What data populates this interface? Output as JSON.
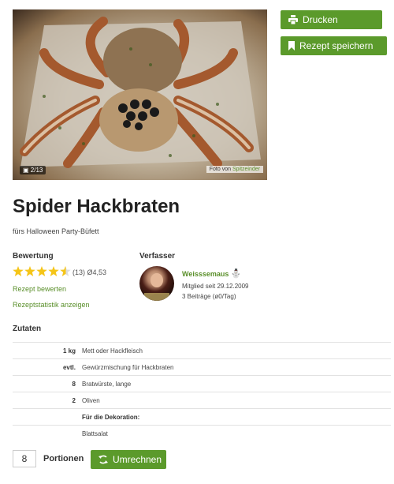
{
  "photo": {
    "count": "2/13",
    "credit_prefix": "Foto von",
    "credit_author": "Spitzeinder"
  },
  "actions": {
    "print_label": "Drucken",
    "save_label": "Rezept speichern"
  },
  "recipe": {
    "title": "Spider Hackbraten",
    "subtitle": "fürs Halloween Party-Büfett"
  },
  "rating": {
    "heading": "Bewertung",
    "stars": 4.5,
    "summary": "(13) Ø4,53",
    "rate_link": "Rezept bewerten",
    "stats_link": "Rezeptstatistik anzeigen"
  },
  "author": {
    "heading": "Verfasser",
    "name": "Weisssemaus",
    "member_since": "Mitglied seit 29.12.2009",
    "posts": "3 Beiträge (ø0/Tag)"
  },
  "ingredients": {
    "heading": "Zutaten",
    "rows": [
      {
        "amount": "1 kg",
        "name": "Mett oder Hackfleisch"
      },
      {
        "amount": "evtl.",
        "name": "Gewürzmischung für Hackbraten"
      },
      {
        "amount": "8",
        "name": "Bratwürste, lange"
      },
      {
        "amount": "2",
        "name": "Oliven"
      },
      {
        "amount": "",
        "name": "Für die Dekoration:",
        "section": true
      },
      {
        "amount": "",
        "name": "Blattsalat"
      }
    ]
  },
  "portions": {
    "value": "8",
    "label": "Portionen",
    "recalc_label": "Umrechnen"
  },
  "colors": {
    "accent": "#5b9a2b",
    "link": "#5a8f2a",
    "star": "#f5c518"
  }
}
